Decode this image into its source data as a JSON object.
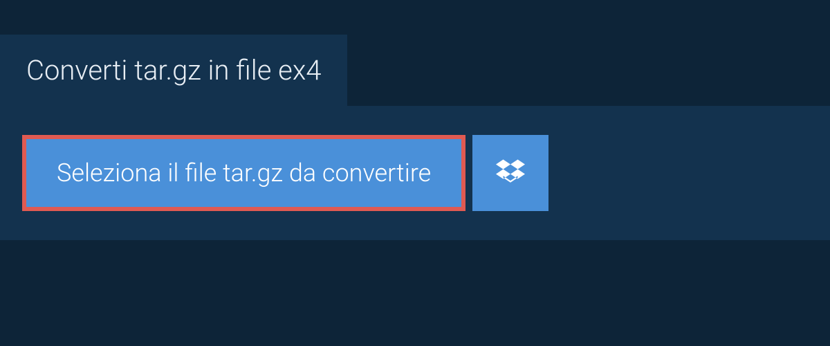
{
  "title": "Converti tar.gz in file ex4",
  "actions": {
    "select_file_label": "Seleziona il file tar.gz da convertire"
  },
  "colors": {
    "background": "#0d2438",
    "panel": "#13324e",
    "button": "#4a90d9",
    "highlight_border": "#e05a52",
    "text": "#ffffff"
  }
}
